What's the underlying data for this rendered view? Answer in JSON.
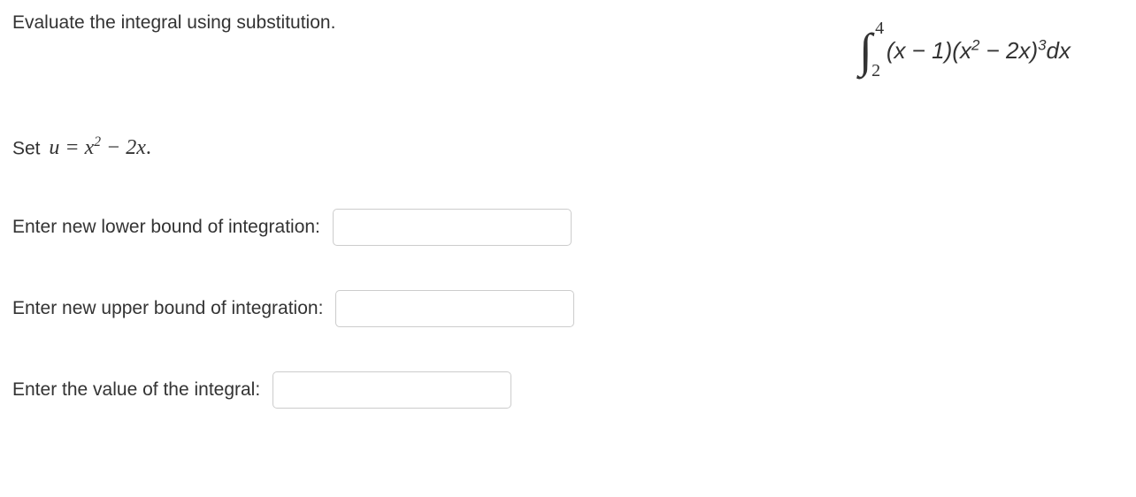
{
  "instruction": "Evaluate the integral using substitution.",
  "integral": {
    "lower_bound": "2",
    "upper_bound": "4",
    "expr_part1": "(",
    "expr_x1": "x",
    "expr_minus1": " − 1)(",
    "expr_x2": "x",
    "expr_sq": "2",
    "expr_minus2": " − 2",
    "expr_x3": "x",
    "expr_close": ")",
    "expr_cube": "3",
    "expr_dx_d": "d",
    "expr_dx_x": "x"
  },
  "substitution": {
    "set_label": "Set",
    "u": "u",
    "equals": " = ",
    "x": "x",
    "sq": "2",
    "minus": " − 2",
    "x2": "x",
    "dot": "."
  },
  "inputs": {
    "lower_label": "Enter new lower bound of integration:",
    "upper_label": "Enter new upper bound of integration:",
    "value_label": "Enter the value of the integral:",
    "lower_value": "",
    "upper_value": "",
    "integral_value": ""
  }
}
